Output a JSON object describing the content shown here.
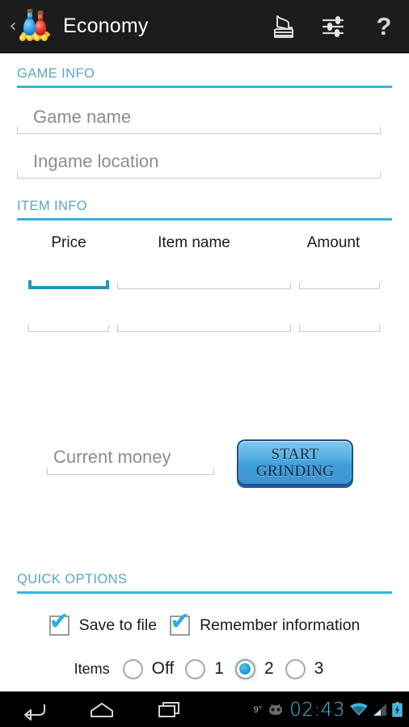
{
  "app": {
    "title": "Economy",
    "icon": "potion-bottles-coins-icon",
    "up_caret": "‹"
  },
  "action_bar": {
    "actions": [
      {
        "name": "notes-stack-icon",
        "label": "Notes"
      },
      {
        "name": "tune-sliders-icon",
        "label": "Settings"
      },
      {
        "name": "help-question-icon",
        "label": "?"
      }
    ],
    "help_glyph": "?"
  },
  "sections": {
    "game_info": {
      "label": "GAME INFO",
      "fields": [
        {
          "name": "game-name-input",
          "placeholder": "Game name",
          "value": ""
        },
        {
          "name": "ingame-location-input",
          "placeholder": "Ingame location",
          "value": ""
        }
      ]
    },
    "item_info": {
      "label": "ITEM INFO",
      "columns": [
        "Price",
        "Item name",
        "Amount"
      ],
      "rows": [
        {
          "price": "",
          "item_name": "",
          "amount": "",
          "focused_cell": "price"
        },
        {
          "price": "",
          "item_name": "",
          "amount": "",
          "focused_cell": ""
        }
      ]
    },
    "quick_options": {
      "label": "QUICK OPTIONS",
      "checkboxes": [
        {
          "name": "save-to-file-checkbox",
          "label": "Save to file",
          "checked": true
        },
        {
          "name": "remember-information-checkbox",
          "label": "Remember information",
          "checked": true
        }
      ],
      "items_group": {
        "label": "Items",
        "options": [
          "Off",
          "1",
          "2",
          "3"
        ],
        "selected": "2"
      }
    }
  },
  "money": {
    "placeholder": "Current money",
    "value": ""
  },
  "grind_button": {
    "line1": "START",
    "line2": "GRINDING"
  },
  "nav_bar": {
    "buttons": [
      {
        "name": "back-button"
      },
      {
        "name": "home-button"
      },
      {
        "name": "recents-button"
      }
    ],
    "status": {
      "temperature": "9°",
      "cyanogen_icon": "cyanogenmod-head-icon",
      "clock": "02:43",
      "wifi_icon": "wifi-icon",
      "signal_icon": "cellular-signal-icon",
      "battery_icon": "battery-charging-icon"
    }
  },
  "colors": {
    "accent_rule": "#32b3e0",
    "section_label": "#59a6c2",
    "focus_underline": "#1d96bd",
    "checkbox_tick": "#2aaede",
    "radio_fill": "#1596cf",
    "clock": "#3fc1ea",
    "action_bar_bg": "#1c1c1c"
  }
}
